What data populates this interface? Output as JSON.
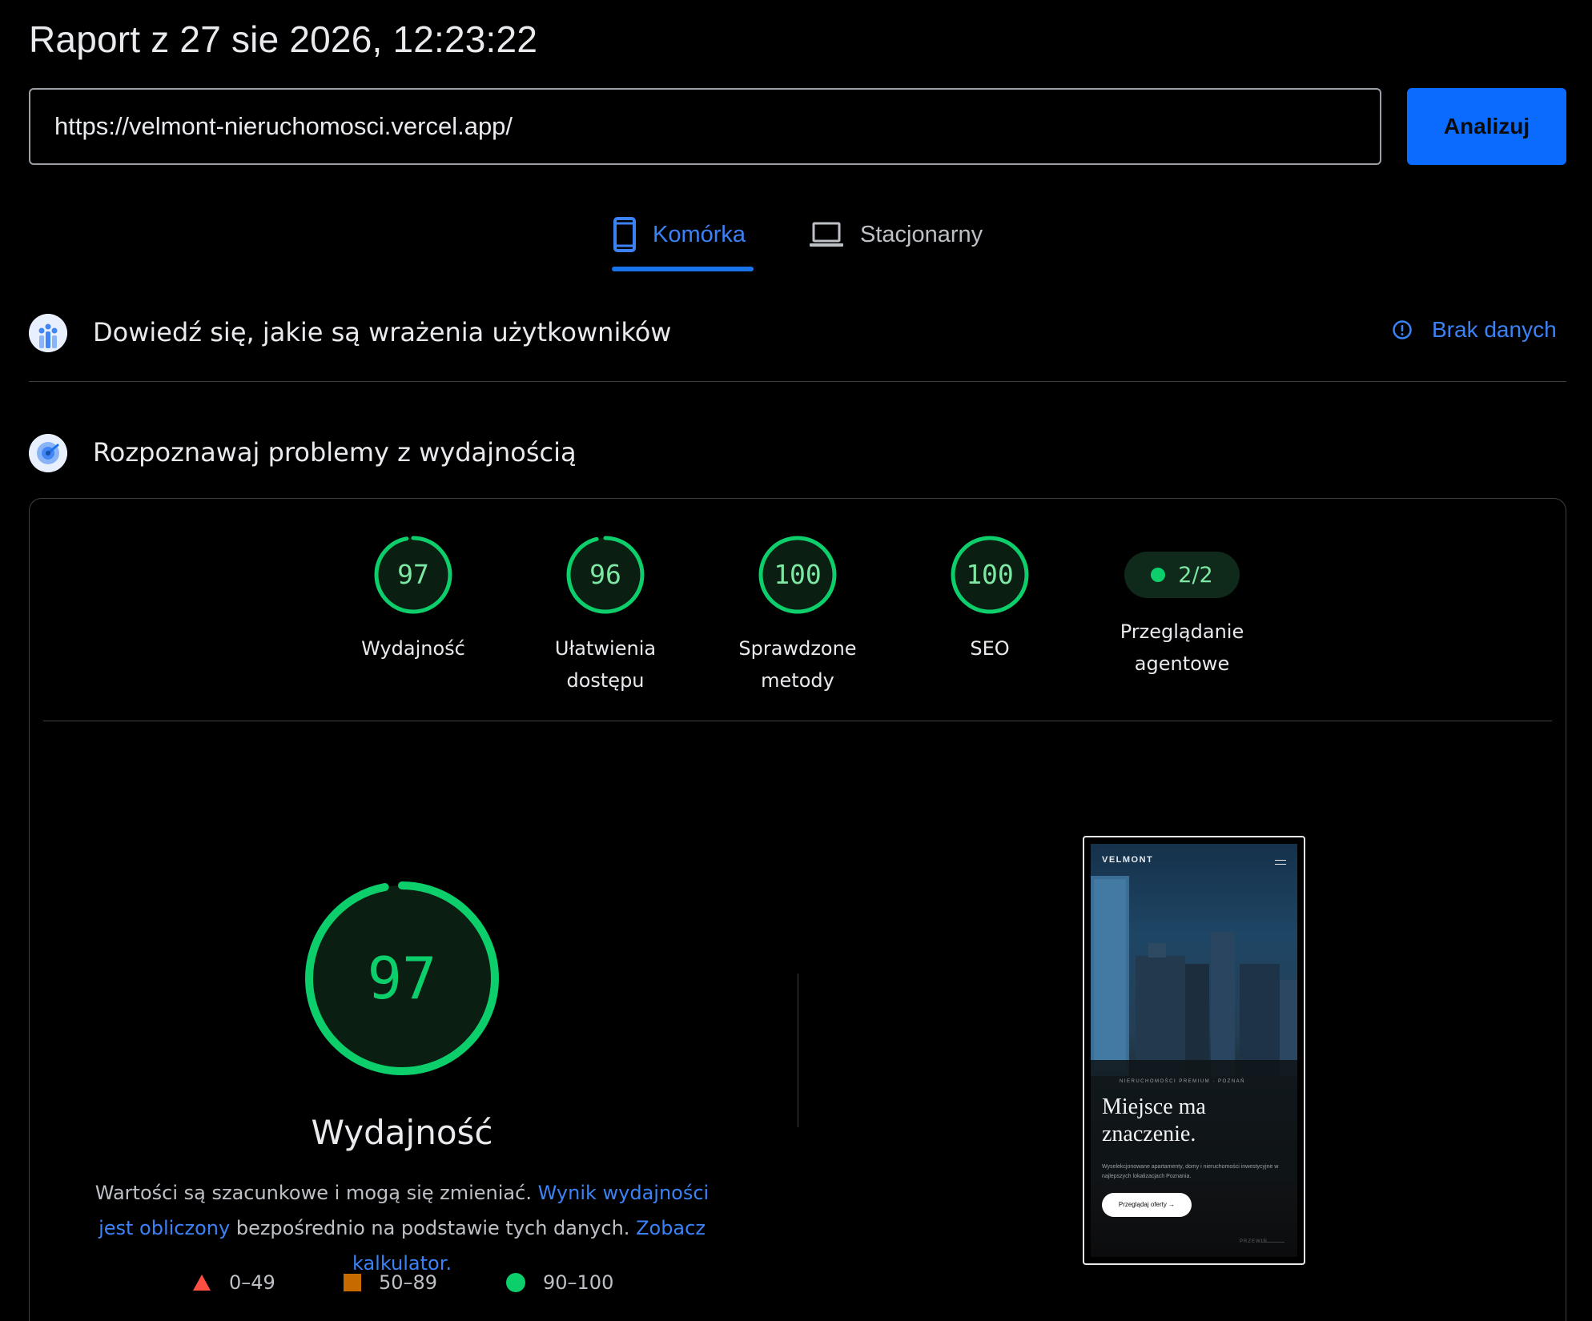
{
  "header": {
    "title": "Raport z 27 sie 2026, 12:23:22"
  },
  "search": {
    "url": "https://velmont-nieruchomosci.vercel.app/",
    "analyze_label": "Analizuj"
  },
  "tabs": [
    {
      "label": "Komórka",
      "icon": "smartphone-icon",
      "active": true
    },
    {
      "label": "Stacjonarny",
      "icon": "laptop-icon",
      "active": false
    }
  ],
  "ux_section": {
    "title": "Dowiedź się, jakie są wrażenia użytkowników",
    "status_label": "Brak danych",
    "status_icon": "info-icon"
  },
  "perf_section": {
    "title": "Rozpoznawaj problemy z wydajnością"
  },
  "scores": [
    {
      "value": "97",
      "score": 97,
      "label_line1": "Wydajność",
      "label_line2": ""
    },
    {
      "value": "96",
      "score": 96,
      "label_line1": "Ułatwienia",
      "label_line2": "dostępu"
    },
    {
      "value": "100",
      "score": 100,
      "label_line1": "Sprawdzone",
      "label_line2": "metody"
    },
    {
      "value": "100",
      "score": 100,
      "label_line1": "SEO",
      "label_line2": ""
    }
  ],
  "agentic": {
    "value": "2/2",
    "label_line1": "Przeglądanie",
    "label_line2": "agentowe"
  },
  "performance": {
    "score": "97",
    "score_value": 97,
    "label": "Wydajność",
    "desc_part1": "Wartości są szacunkowe i mogą się zmieniać. ",
    "desc_link1": "Wynik wydajności jest obliczony",
    "desc_part2": " bezpośrednio na podstawie tych danych. ",
    "desc_link2": "Zobacz kalkulator."
  },
  "legend": [
    {
      "range": "0–49",
      "shape": "triangle",
      "color": "#ff4e42"
    },
    {
      "range": "50–89",
      "shape": "square",
      "color": "#c76a00"
    },
    {
      "range": "90–100",
      "shape": "circle",
      "color": "#0cce6b"
    }
  ],
  "screenshot": {
    "brand": "VELMONT",
    "kicker": "NIERUCHOMOŚCI PREMIUM · POZNAŃ",
    "hero_line1": "Miejsce ma",
    "hero_line2": "znaczenie.",
    "subtitle": "Wyselekcjonowane apartamenty, domy i nieruchomości inwestycyjne w najlepszych lokalizacjach Poznania.",
    "cta": "Przeglądaj oferty →",
    "scroll": "PRZEWIŃ"
  },
  "colors": {
    "accent": "#1a73e8",
    "pass": "#0cce6b",
    "pass_text": "#7ee7a4"
  }
}
